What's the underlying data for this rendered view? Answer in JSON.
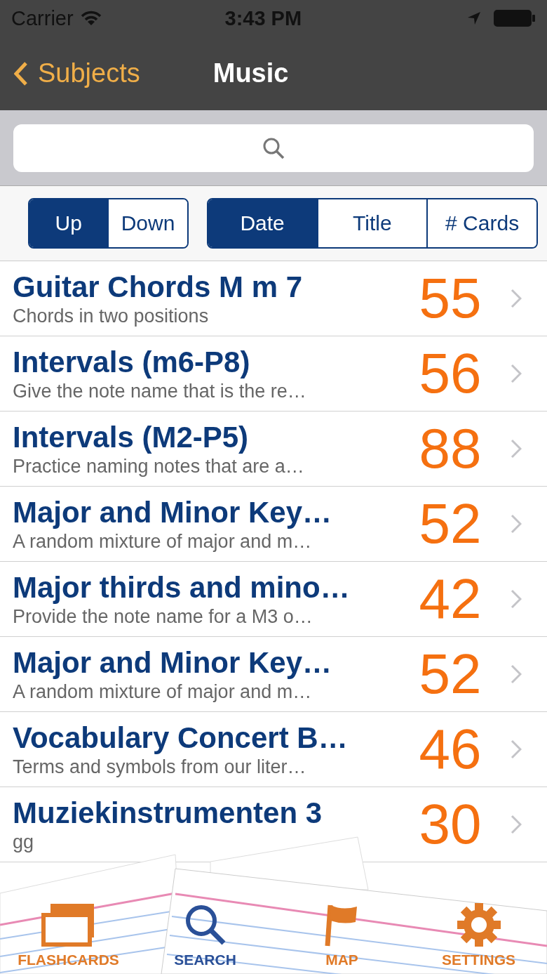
{
  "status_bar": {
    "carrier": "Carrier",
    "time": "3:43 PM"
  },
  "nav": {
    "back": "Subjects",
    "title": "Music"
  },
  "sort_groups": [
    {
      "options": [
        {
          "label": "Up",
          "selected": true
        },
        {
          "label": "Down",
          "selected": false
        }
      ]
    },
    {
      "options": [
        {
          "label": "Date",
          "selected": true
        },
        {
          "label": "Title",
          "selected": false
        },
        {
          "label": "# Cards",
          "selected": false
        }
      ]
    }
  ],
  "decks": [
    {
      "title": "Guitar Chords M m 7",
      "subtitle": "Chords in two positions",
      "count": "55"
    },
    {
      "title": "Intervals (m6-P8)",
      "subtitle": "Give the note name that is the re…",
      "count": "56"
    },
    {
      "title": "Intervals (M2-P5)",
      "subtitle": "Practice naming notes that are a…",
      "count": "88"
    },
    {
      "title": "Major and Minor Key…",
      "subtitle": "A random mixture of major and m…",
      "count": "52"
    },
    {
      "title": "Major thirds and mino…",
      "subtitle": "Provide the note name for a M3 o…",
      "count": "42"
    },
    {
      "title": "Major and Minor Key…",
      "subtitle": "A random mixture of major and m…",
      "count": "52"
    },
    {
      "title": "Vocabulary Concert B…",
      "subtitle": "Terms and symbols from our liter…",
      "count": "46"
    },
    {
      "title": "Muziekinstrumenten 3",
      "subtitle": "gg",
      "count": "30"
    }
  ],
  "tab_bar": [
    {
      "label": "FLASHCARDS",
      "kind": "folder",
      "selected": false
    },
    {
      "label": "SEARCH",
      "kind": "search",
      "selected": true
    },
    {
      "label": "MAP",
      "kind": "flag",
      "selected": false
    },
    {
      "label": "SETTINGS",
      "kind": "gear",
      "selected": false
    }
  ]
}
